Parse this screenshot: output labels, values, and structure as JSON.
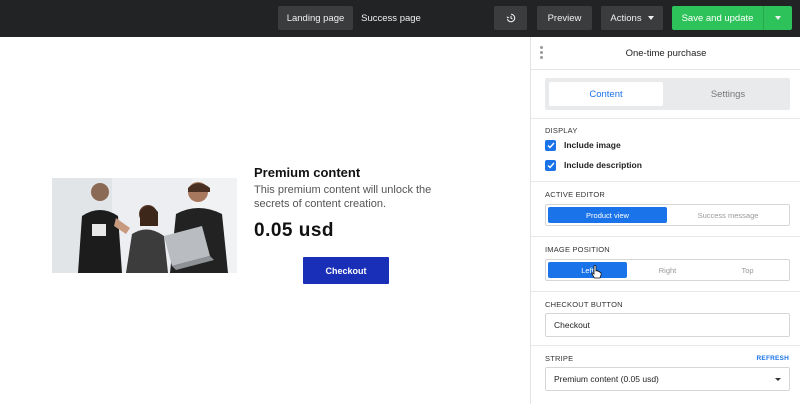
{
  "topbar": {
    "tabs": [
      "Landing page",
      "Success page"
    ],
    "undo_icon": "history-icon",
    "preview_label": "Preview",
    "actions_label": "Actions",
    "save_label": "Save and update"
  },
  "product": {
    "title": "Premium content",
    "description": "This premium content will unlock the secrets of content creation.",
    "price": "0.05 usd",
    "checkout_label": "Checkout",
    "image_icon": "product-photo"
  },
  "panel": {
    "title": "One-time purchase",
    "tabs": {
      "content": "Content",
      "settings": "Settings"
    },
    "display": {
      "label": "DISPLAY",
      "include_image": "Include image",
      "include_description": "Include description"
    },
    "active_editor": {
      "label": "ACTIVE EDITOR",
      "options": [
        "Product view",
        "Success message"
      ],
      "selected": "Product view"
    },
    "image_position": {
      "label": "IMAGE POSITION",
      "options": [
        "Left",
        "Right",
        "Top"
      ],
      "selected": "Left"
    },
    "checkout_button": {
      "label": "CHECKOUT BUTTON",
      "value": "Checkout"
    },
    "stripe": {
      "label": "STRIPE",
      "refresh": "REFRESH",
      "selected": "Premium content (0.05 usd)"
    }
  },
  "colors": {
    "topbar_bg": "#212325",
    "accent": "#1a73e8",
    "save_green": "#2ec25a",
    "checkout_blue": "#1a2fb8"
  }
}
